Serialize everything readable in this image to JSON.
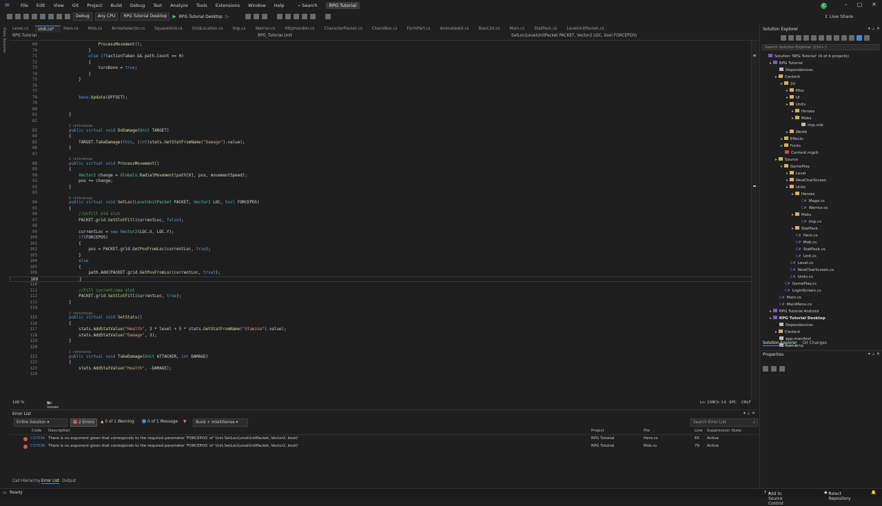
{
  "menu": {
    "items": [
      "File",
      "Edit",
      "View",
      "Git",
      "Project",
      "Build",
      "Debug",
      "Test",
      "Analyze",
      "Tools",
      "Extensions",
      "Window",
      "Help"
    ],
    "search": "Search",
    "solution_name": "RPG Tutorial",
    "live_share": "Live Share",
    "avatar": "C"
  },
  "toolbar": {
    "config": "Debug",
    "platform": "Any CPU",
    "startup": "RPG Tutorial Desktop",
    "run_label": "RPG Tutorial Desktop"
  },
  "left_strip": {
    "label": "Data Sources"
  },
  "tabs": [
    "Level.cs",
    "Unit.cs*",
    "Hero.cs",
    "Mob.cs",
    "ArrowSelector.cs",
    "SquareGrid.cs",
    "GridLocation.cs",
    "Imp.cs",
    "Warrior.cs",
    "HttpHandler.cs",
    "CharacterPacket.cs",
    "CheckBox.cs",
    "FormPart.cs",
    "AnimatedUI.cs",
    "Basic2d.cs",
    "Main.cs",
    "StatPack.cs",
    "LevelUnitPacket.cs"
  ],
  "navbar": {
    "project": "RPG Tutorial",
    "class": "RPG_Tutorial.Unit",
    "member": "SetLoc(LevelUnitPacket PACKET, Vector2 LOC, bool FORCEPOS)"
  },
  "code": [
    {
      "n": "69",
      "t": "            ProcessMovement();"
    },
    {
      "n": "70",
      "t": "        }"
    },
    {
      "n": "71",
      "t": "        else if(actionTaken && path.Count == 0)"
    },
    {
      "n": "72",
      "t": "        {"
    },
    {
      "n": "73",
      "t": "            turnDone = true;"
    },
    {
      "n": "74",
      "t": "        }"
    },
    {
      "n": "75",
      "t": "    }"
    },
    {
      "n": "76",
      "t": ""
    },
    {
      "n": "77",
      "t": ""
    },
    {
      "n": "78",
      "t": "    base.Update(OFFSET);"
    },
    {
      "n": "79",
      "t": ""
    },
    {
      "n": "80",
      "t": ""
    },
    {
      "n": "81",
      "t": "}"
    },
    {
      "n": "82",
      "t": ""
    },
    {
      "n": "83",
      "t": "public virtual void DoDamage(Unit TARGET)",
      "lens": "2 references"
    },
    {
      "n": "84",
      "t": "{"
    },
    {
      "n": "85",
      "t": "    TARGET.TakeDamage(this, (int)stats.GetStatFromName(\"Damage\").value);"
    },
    {
      "n": "86",
      "t": "}"
    },
    {
      "n": "87",
      "t": ""
    },
    {
      "n": "88",
      "t": "public virtual void ProcessMovement()",
      "lens": "2 references"
    },
    {
      "n": "89",
      "t": "{"
    },
    {
      "n": "90",
      "t": "    Vector2 change = Globals.RadialMovement(path[0], pos, movementSpeed);"
    },
    {
      "n": "91",
      "t": "    pos += change;"
    },
    {
      "n": "92",
      "t": "}"
    },
    {
      "n": "93",
      "t": ""
    },
    {
      "n": "94",
      "t": "public virtual void SetLoc(LevelUnitPacket PACKET, Vector2 LOC, bool FORCEPOS)",
      "lens": "5 references"
    },
    {
      "n": "95",
      "t": "{"
    },
    {
      "n": "96",
      "t": "    //Unfill old slot"
    },
    {
      "n": "97",
      "t": "    PACKET.grid.SetSlotFill(currentLoc, false);"
    },
    {
      "n": "98",
      "t": ""
    },
    {
      "n": "99",
      "t": "    currentLoc = new Vector2(LOC.X, LOC.Y);"
    },
    {
      "n": "100",
      "t": "    if(FORCEPOS)"
    },
    {
      "n": "101",
      "t": "    {"
    },
    {
      "n": "102",
      "t": "        pos = PACKET.grid.GetPosFromLoc(currentLoc, true);"
    },
    {
      "n": "103",
      "t": "    }"
    },
    {
      "n": "104",
      "t": "    else"
    },
    {
      "n": "105",
      "t": "    {"
    },
    {
      "n": "106",
      "t": "        path.Add(PACKET.grid.GetPosFromLoc(currentLoc, true));"
    },
    {
      "n": "109",
      "t": "    }"
    },
    {
      "n": "110",
      "t": ""
    },
    {
      "n": "111",
      "t": "    //Fill current/new slot"
    },
    {
      "n": "112",
      "t": "    PACKET.grid.SetSlotFill(currentLoc, true);"
    },
    {
      "n": "113",
      "t": "}"
    },
    {
      "n": "114",
      "t": ""
    },
    {
      "n": "115",
      "t": "public virtual void SetStats()",
      "lens": "2 references"
    },
    {
      "n": "116",
      "t": "{"
    },
    {
      "n": "117",
      "t": "    stats.AddStatValue(\"Health\", 3 * level + 5 * stats.GetStatFromName(\"Stamina\").value);"
    },
    {
      "n": "118",
      "t": "    stats.AddStatValue(\"Damage\", 3);"
    },
    {
      "n": "119",
      "t": "}"
    },
    {
      "n": "120",
      "t": ""
    },
    {
      "n": "121",
      "t": "public virtual void TakeDamage(Unit ATTACKER, int DAMAGE)",
      "lens": "1 reference"
    },
    {
      "n": "122",
      "t": "{"
    },
    {
      "n": "123",
      "t": "    stats.AddStatValue(\"Health\", -DAMAGE);"
    },
    {
      "n": "124",
      "t": ""
    }
  ],
  "editor_status": {
    "zoom": "100 %",
    "issues": "No issues found",
    "ln": "Ln: 108",
    "ch": "Ch: 14",
    "spc": "SPC",
    "crlf": "CRLF"
  },
  "error_list": {
    "title": "Error List",
    "scope": "Entire Solution",
    "errors": "2 Errors",
    "warnings": "0 of 1 Warning",
    "messages": "0 of 1 Message",
    "build": "Build + IntelliSense",
    "search_placeholder": "Search Error List",
    "headers": {
      "code": "Code",
      "description": "Description",
      "project": "Project",
      "file": "File",
      "line": "Line",
      "state": "Suppression State"
    },
    "rows": [
      {
        "code": "CS7036",
        "desc": "There is no argument given that corresponds to the required parameter 'FORCEPOS' of 'Unit.SetLoc(LevelUnitPacket, Vector2, bool)'",
        "project": "RPG Tutorial",
        "file": "Hero.cs",
        "line": "65",
        "state": "Active"
      },
      {
        "code": "CS7036",
        "desc": "There is no argument given that corresponds to the required parameter 'FORCEPOS' of 'Unit.SetLoc(LevelUnitPacket, Vector2, bool)'",
        "project": "RPG Tutorial",
        "file": "Mob.cs",
        "line": "79",
        "state": "Active"
      }
    ],
    "bottom_tabs": [
      "Call Hierarchy",
      "Error List",
      "Output"
    ]
  },
  "solution_explorer": {
    "title": "Solution Explorer",
    "search_placeholder": "Search Solution Explorer (Ctrl+;)",
    "items": [
      {
        "d": 0,
        "label": "Solution 'RPG Tutorial' (4 of 4 projects)",
        "k": "sln"
      },
      {
        "d": 1,
        "label": "RPG Tutorial",
        "k": "proj"
      },
      {
        "d": 2,
        "label": "Dependencies",
        "k": "file"
      },
      {
        "d": 2,
        "label": "Content",
        "k": "folder"
      },
      {
        "d": 3,
        "label": "2d",
        "k": "folder"
      },
      {
        "d": 4,
        "label": "Misc",
        "k": "folder"
      },
      {
        "d": 4,
        "label": "UI",
        "k": "folder"
      },
      {
        "d": 4,
        "label": "Units",
        "k": "folder"
      },
      {
        "d": 5,
        "label": "Heroes",
        "k": "folder"
      },
      {
        "d": 5,
        "label": "Mobs",
        "k": "folder"
      },
      {
        "d": 6,
        "label": "Imp.xnb",
        "k": "file"
      },
      {
        "d": 4,
        "label": "World",
        "k": "folder"
      },
      {
        "d": 3,
        "label": "Effects",
        "k": "folder"
      },
      {
        "d": 3,
        "label": "Fonts",
        "k": "folder"
      },
      {
        "d": 3,
        "label": "Content.mgcb",
        "k": "red"
      },
      {
        "d": 2,
        "label": "Source",
        "k": "folder"
      },
      {
        "d": 3,
        "label": "GamePlay",
        "k": "folder"
      },
      {
        "d": 4,
        "label": "Level",
        "k": "folder"
      },
      {
        "d": 4,
        "label": "NewCharScreen",
        "k": "folder"
      },
      {
        "d": 4,
        "label": "Units",
        "k": "folder"
      },
      {
        "d": 5,
        "label": "Heroes",
        "k": "folder"
      },
      {
        "d": 6,
        "label": "Mage.cs",
        "k": "cs"
      },
      {
        "d": 6,
        "label": "Warrior.cs",
        "k": "cs"
      },
      {
        "d": 5,
        "label": "Mobs",
        "k": "folder"
      },
      {
        "d": 6,
        "label": "Imp.cs",
        "k": "cs"
      },
      {
        "d": 5,
        "label": "StatPack",
        "k": "folder"
      },
      {
        "d": 5,
        "label": "Hero.cs",
        "k": "cs"
      },
      {
        "d": 5,
        "label": "Mob.cs",
        "k": "cs"
      },
      {
        "d": 5,
        "label": "StatPack.cs",
        "k": "cs"
      },
      {
        "d": 5,
        "label": "Unit.cs",
        "k": "cs"
      },
      {
        "d": 4,
        "label": "Level.cs",
        "k": "cs"
      },
      {
        "d": 4,
        "label": "NewCharScreen.cs",
        "k": "cs"
      },
      {
        "d": 4,
        "label": "Units.cs",
        "k": "cs"
      },
      {
        "d": 3,
        "label": "GamePlay.cs",
        "k": "cs"
      },
      {
        "d": 3,
        "label": "LoginScreen.cs",
        "k": "cs"
      },
      {
        "d": 2,
        "label": "Main.cs",
        "k": "cs"
      },
      {
        "d": 2,
        "label": "MainMenu.cs",
        "k": "cs"
      },
      {
        "d": 1,
        "label": "RPG Tutorial Android",
        "k": "proj"
      },
      {
        "d": 1,
        "label": "RPG Tutorial Desktop",
        "k": "projbold"
      },
      {
        "d": 2,
        "label": "Dependencies",
        "k": "file"
      },
      {
        "d": 2,
        "label": "Content",
        "k": "folder"
      },
      {
        "d": 2,
        "label": "app.manifest",
        "k": "file"
      },
      {
        "d": 2,
        "label": "Icon.bmp",
        "k": "file"
      }
    ],
    "tabs": [
      "Solution Explorer",
      "Git Changes"
    ]
  },
  "properties": {
    "title": "Properties"
  },
  "statusbar": {
    "ready": "Ready",
    "source_control": "Add to Source Control",
    "repository": "Select Repository"
  }
}
